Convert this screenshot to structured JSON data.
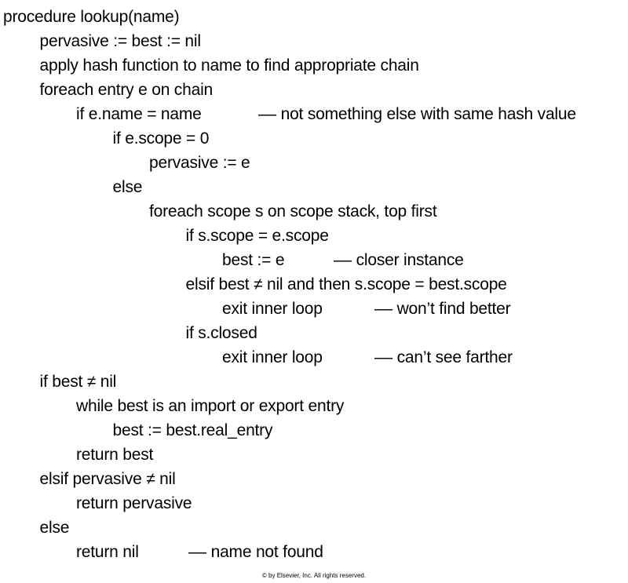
{
  "code_lines": [
    {
      "indent": 0,
      "text": "procedure lookup(name)",
      "comment": ""
    },
    {
      "indent": 1,
      "text": "pervasive := best := nil",
      "comment": ""
    },
    {
      "indent": 1,
      "text": "apply hash function to name to find appropriate chain",
      "comment": ""
    },
    {
      "indent": 1,
      "text": "foreach entry e on chain",
      "comment": ""
    },
    {
      "indent": 2,
      "text": "if e.name = name",
      "comment": "–– not something else with same hash value"
    },
    {
      "indent": 3,
      "text": "if e.scope = 0",
      "comment": ""
    },
    {
      "indent": 4,
      "text": "pervasive := e",
      "comment": ""
    },
    {
      "indent": 3,
      "text": "else",
      "comment": ""
    },
    {
      "indent": 4,
      "text": "foreach scope s on scope stack, top first",
      "comment": ""
    },
    {
      "indent": 5,
      "text": "if s.scope = e.scope",
      "comment": ""
    },
    {
      "indent": 6,
      "text": "best := e",
      "comment": "–– closer instance"
    },
    {
      "indent": 5,
      "text": "elsif best ≠ nil and then s.scope = best.scope",
      "comment": ""
    },
    {
      "indent": 6,
      "text": "exit inner loop",
      "comment": "–– won’t find better"
    },
    {
      "indent": 5,
      "text": "if s.closed",
      "comment": ""
    },
    {
      "indent": 6,
      "text": "exit inner loop",
      "comment": "–– can’t see farther"
    },
    {
      "indent": 1,
      "text": "if best ≠ nil",
      "comment": ""
    },
    {
      "indent": 2,
      "text": "while best is an import or export entry",
      "comment": ""
    },
    {
      "indent": 3,
      "text": "best := best.real_entry",
      "comment": ""
    },
    {
      "indent": 2,
      "text": "return best",
      "comment": ""
    },
    {
      "indent": 1,
      "text": "elsif pervasive ≠ nil",
      "comment": ""
    },
    {
      "indent": 2,
      "text": "return pervasive",
      "comment": ""
    },
    {
      "indent": 1,
      "text": "else",
      "comment": ""
    },
    {
      "indent": 2,
      "text": "return nil",
      "comment": "–– name not found"
    }
  ],
  "footer": {
    "copyright": "© by Elsevier, Inc. All rights reserved."
  }
}
